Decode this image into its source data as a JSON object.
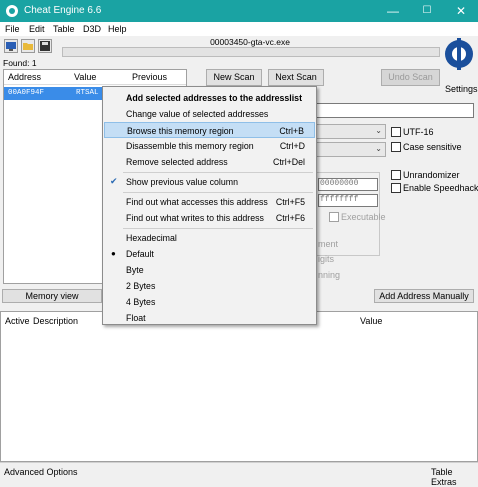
{
  "window": {
    "title": "Cheat Engine 6.6",
    "minimize": "—",
    "maximize": "☐",
    "close": "✕"
  },
  "menubar": [
    "File",
    "Edit",
    "Table",
    "D3D",
    "Help"
  ],
  "process_name": "00003450-gta-vc.exe",
  "found_label": "Found: 1",
  "settings_label": "Settings",
  "address_list": {
    "headers": [
      "Address",
      "Value",
      "Previous"
    ],
    "rows": [
      {
        "address": "00A0F94F",
        "value": "RTSAL"
      }
    ]
  },
  "buttons": {
    "new_scan": "New Scan",
    "next_scan": "Next Scan",
    "undo_scan": "Undo Scan",
    "memory_view": "Memory view",
    "add_address": "Add Address Manually"
  },
  "options": {
    "utf16": "UTF-16",
    "case_sensitive": "Case sensitive",
    "unrandomizer": "Unrandomizer",
    "enable_speedhack": "Enable Speedhack",
    "executable": "Executable",
    "start_partial": "00000000",
    "stop_partial": "ffffffff",
    "fragment_1": "ment",
    "fragment_2": "igits",
    "fragment_3": "nning"
  },
  "context_menu": [
    {
      "label": "Add selected addresses to the addresslist",
      "shortcut": "",
      "bold": true
    },
    {
      "label": "Change value of selected addresses",
      "shortcut": ""
    },
    {
      "label": "Browse this memory region",
      "shortcut": "Ctrl+B",
      "highlighted": true
    },
    {
      "label": "Disassemble this memory region",
      "shortcut": "Ctrl+D"
    },
    {
      "label": "Remove selected address",
      "shortcut": "Ctrl+Del"
    },
    {
      "label": "Show previous value column",
      "shortcut": "",
      "check": "✔"
    },
    {
      "label": "Find out what accesses this address",
      "shortcut": "Ctrl+F5"
    },
    {
      "label": "Find out what writes to this address",
      "shortcut": "Ctrl+F6"
    },
    {
      "label": "Hexadecimal",
      "shortcut": ""
    },
    {
      "label": "Default",
      "shortcut": "",
      "check": "●"
    },
    {
      "label": "Byte",
      "shortcut": ""
    },
    {
      "label": "2 Bytes",
      "shortcut": ""
    },
    {
      "label": "4 Bytes",
      "shortcut": ""
    },
    {
      "label": "Float",
      "shortcut": ""
    }
  ],
  "table_headers": {
    "active": "Active",
    "description": "Description",
    "value": "Value"
  },
  "status": {
    "left": "Advanced Options",
    "right": "Table Extras"
  },
  "icons": {
    "app": "cheat-engine-icon",
    "open_process": "computer-icon",
    "open_file": "folder-icon",
    "save": "disk-icon"
  },
  "colors": {
    "titlebar": "#1aa3a3",
    "selection": "#3a8ce8",
    "menu_highlight": "#c4def5"
  }
}
